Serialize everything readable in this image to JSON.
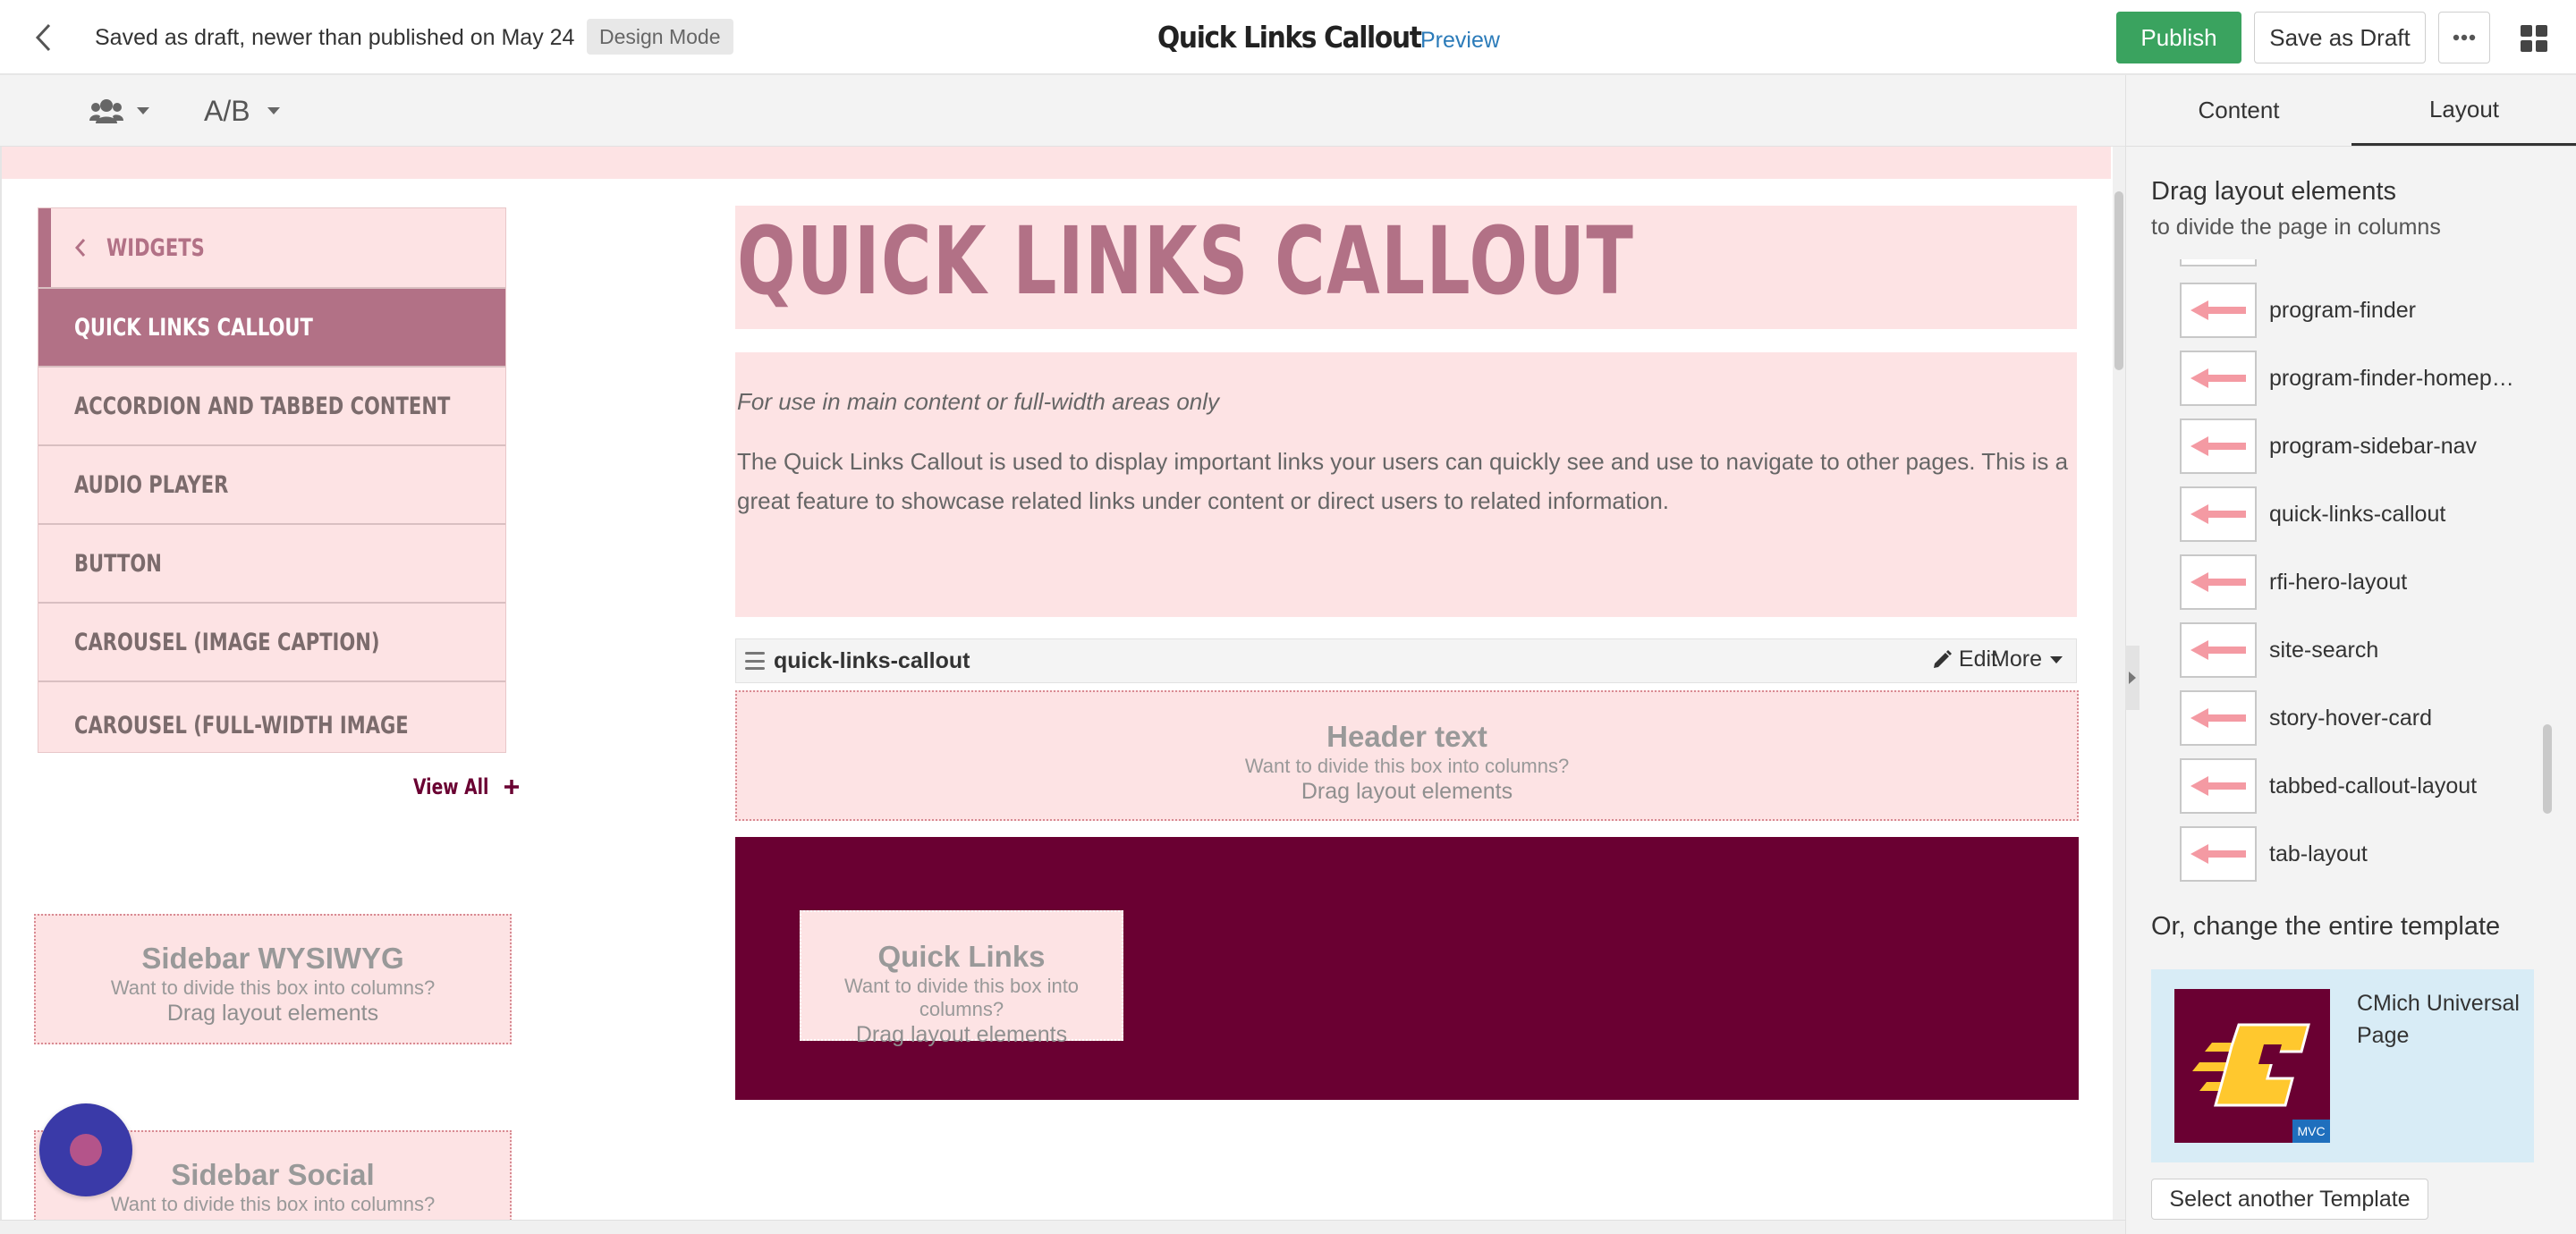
{
  "header": {
    "status_text": "Saved as draft, newer than published on May 24",
    "mode_badge": "Design Mode",
    "page_title": "Quick Links Callout",
    "preview_label": "Preview",
    "publish_label": "Publish",
    "save_draft_label": "Save as Draft"
  },
  "toolbar": {
    "ab_label": "A/B"
  },
  "canvas": {
    "widgets_back_label": "WIDGETS",
    "widgets": [
      {
        "label": "QUICK LINKS CALLOUT",
        "active": true
      },
      {
        "label": "ACCORDION AND TABBED CONTENT",
        "active": false
      },
      {
        "label": "AUDIO PLAYER",
        "active": false
      },
      {
        "label": "BUTTON",
        "active": false
      },
      {
        "label": "CAROUSEL (IMAGE CAPTION)",
        "active": false
      },
      {
        "label": "CAROUSEL (FULL-WIDTH IMAGE BACKGROUND)",
        "active": false
      }
    ],
    "view_all_label": "View All",
    "sidebar_wysiwyg": {
      "title": "Sidebar WYSIWYG",
      "hint": "Want to divide this box into columns?",
      "action": "Drag layout elements"
    },
    "sidebar_social": {
      "title": "Sidebar Social",
      "hint": "Want to divide this box into columns?"
    },
    "main_title": "QUICK LINKS CALLOUT",
    "usage_note": "For use in main content or full-width areas only",
    "description": "The Quick Links Callout is used to display important links your users can quickly see and use to navigate to other pages. This is a great feature to showcase related links under content or direct users to related information.",
    "component_name": "quick-links-callout",
    "edit_label": "Edit",
    "more_label": "More",
    "header_box": {
      "title": "Header text",
      "hint": "Want to divide this box into columns?",
      "action": "Drag layout elements"
    },
    "quick_links_box": {
      "title": "Quick Links",
      "hint": "Want to divide this box into columns?",
      "action": "Drag layout elements"
    }
  },
  "right_panel": {
    "tabs": [
      {
        "label": "Content",
        "active": false
      },
      {
        "label": "Layout",
        "active": true
      }
    ],
    "heading": "Drag layout elements",
    "subheading": "to divide the page in columns",
    "layout_items": [
      {
        "label": "program-finder"
      },
      {
        "label": "program-finder-homepage"
      },
      {
        "label": "program-sidebar-nav"
      },
      {
        "label": "quick-links-callout"
      },
      {
        "label": "rfi-hero-layout"
      },
      {
        "label": "site-search"
      },
      {
        "label": "story-hover-card"
      },
      {
        "label": "tabbed-callout-layout"
      },
      {
        "label": "tab-layout"
      }
    ],
    "template_heading": "Or, change the entire template",
    "template_name": "CMich Universal Page",
    "template_tag": "MVC",
    "select_template_label": "Select another Template"
  },
  "colors": {
    "maroon": "#6a0032",
    "mauve": "#b27186",
    "pink_bg": "#fde3e4",
    "publish_green": "#3aa35f",
    "gold": "#ffc82e",
    "link_blue": "#2b7bb9"
  },
  "icons": {
    "back": "chevron-left-icon",
    "more": "ellipsis-icon",
    "apps": "grid-icon",
    "persona": "users-icon",
    "dropdown": "caret-down-icon",
    "edit": "pencil-icon",
    "view_all": "plus-icon",
    "layout_thumb": "arrow-left-icon"
  }
}
